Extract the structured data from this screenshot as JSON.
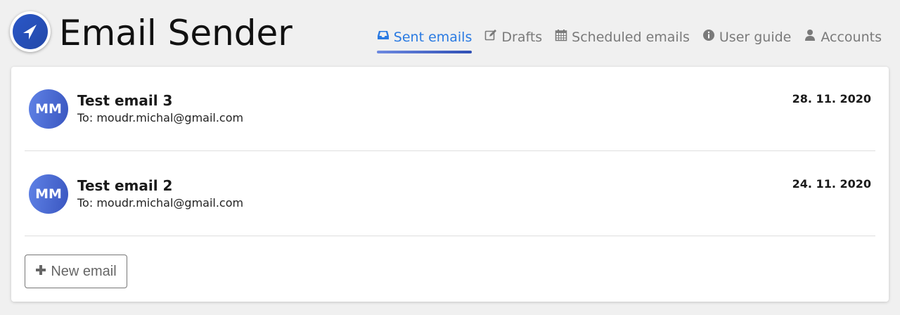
{
  "app": {
    "title": "Email Sender",
    "logo_icon": "paper-plane-icon"
  },
  "nav": {
    "items": [
      {
        "label": "Sent emails",
        "icon": "inbox-icon",
        "active": true
      },
      {
        "label": "Drafts",
        "icon": "edit-icon",
        "active": false
      },
      {
        "label": "Scheduled emails",
        "icon": "calendar-icon",
        "active": false
      },
      {
        "label": "User guide",
        "icon": "info-icon",
        "active": false
      },
      {
        "label": "Accounts",
        "icon": "user-icon",
        "active": false
      }
    ]
  },
  "emails": [
    {
      "avatar": "MM",
      "subject": "Test email 3",
      "recipient": "To: moudr.michal@gmail.com",
      "date": "28. 11. 2020"
    },
    {
      "avatar": "MM",
      "subject": "Test email 2",
      "recipient": "To: moudr.michal@gmail.com",
      "date": "24. 11. 2020"
    }
  ],
  "actions": {
    "new_email_label": "New email",
    "new_email_icon": "plus-icon"
  },
  "colors": {
    "accent": "#2a7ae2",
    "brand": "#2348a8",
    "muted": "#7a7a7a"
  }
}
